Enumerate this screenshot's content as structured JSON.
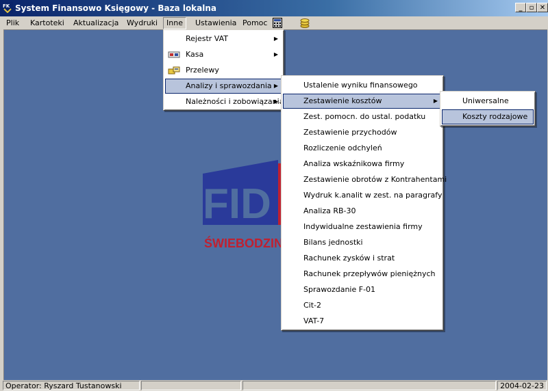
{
  "window": {
    "title": "System Finansowo Księgowy - Baza lokalna",
    "buttons": {
      "minimize": "_",
      "restore": "▫",
      "close": "✕"
    }
  },
  "menubar": {
    "items": [
      "Plik",
      "Kartoteki",
      "Aktualizacja",
      "Wydruki",
      "Inne",
      "Ustawienia",
      "Pomoc"
    ],
    "active": "Inne"
  },
  "logo": {
    "text": "FID",
    "subtext": "ŚWIEBODZIN"
  },
  "menu_inne": {
    "items": [
      {
        "label": "Rejestr VAT",
        "submenu": true,
        "icon": null
      },
      {
        "label": "Kasa",
        "submenu": true,
        "icon": "cash-icon"
      },
      {
        "label": "Przelewy",
        "submenu": false,
        "icon": "transfer-icon"
      },
      {
        "label": "Analizy i sprawozdania",
        "submenu": true,
        "icon": null,
        "selected": true
      },
      {
        "label": "Należności i zobowiązania",
        "submenu": true,
        "icon": null
      }
    ]
  },
  "menu_analizy": {
    "items": [
      {
        "label": "Ustalenie wyniku finansowego"
      },
      {
        "label": "Zestawienie kosztów",
        "submenu": true,
        "selected": true
      },
      {
        "label": "Zest. pomocn. do ustal. podatku"
      },
      {
        "label": "Zestawienie przychodów"
      },
      {
        "label": "Rozliczenie odchyleń"
      },
      {
        "label": "Analiza wskaźnikowa firmy"
      },
      {
        "label": "Zestawienie obrotów z Kontrahentami"
      },
      {
        "label": "Wydruk k.analit w zest. na paragrafy"
      },
      {
        "label": "Analiza RB-30"
      },
      {
        "label": "Indywidualne zestawienia firmy"
      },
      {
        "label": "Bilans jednostki"
      },
      {
        "label": "Rachunek zysków i strat"
      },
      {
        "label": "Rachunek przepływów pieniężnych"
      },
      {
        "label": "Sprawozdanie F-01"
      },
      {
        "label": "Cit-2"
      },
      {
        "label": "VAT-7"
      }
    ]
  },
  "menu_koszty": {
    "items": [
      {
        "label": "Uniwersalne"
      },
      {
        "label": "Koszty rodzajowe",
        "selected": true
      }
    ]
  },
  "statusbar": {
    "operator": "Operator: Ryszard Tustanowski",
    "panel2": "",
    "panel3": "",
    "date": "2004-02-23"
  }
}
